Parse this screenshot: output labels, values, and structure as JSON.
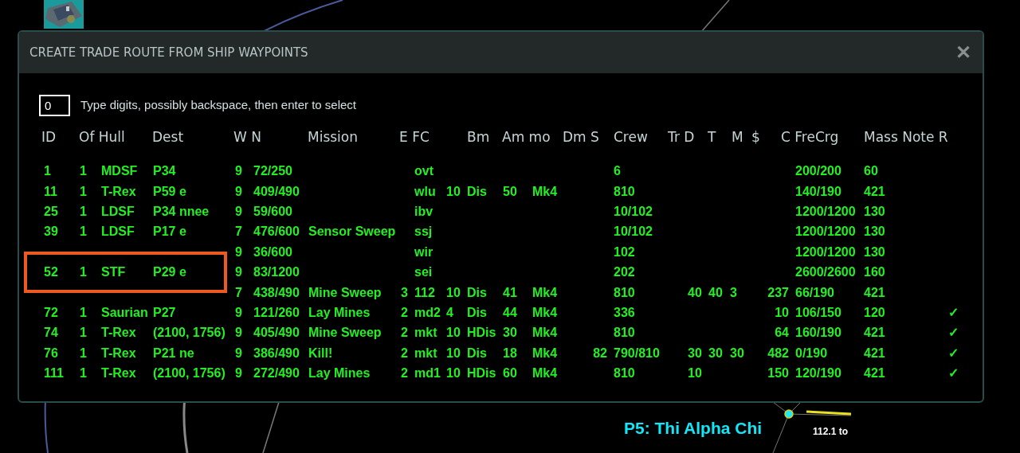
{
  "map": {
    "planet_label": "P5: Thi Alpha Chi",
    "distance_label": "112.1 to"
  },
  "dialog": {
    "title": "CREATE TRADE ROUTE FROM SHIP WAYPOINTS",
    "close_symbol": "✕",
    "selector": {
      "value": "0",
      "hint": "Type digits, possibly backspace, then enter to select"
    },
    "headers": [
      "ID",
      "Of Hull",
      "Dest",
      "W N",
      "Mission",
      "E FC",
      "Bm",
      "Am mo",
      "Dm S",
      "Crew",
      "Tr D",
      "T",
      "M",
      "$",
      "C FreCrg",
      "Mass Note R"
    ],
    "rows": [
      {
        "highlighted": false,
        "cells": {
          "id": "1",
          "of": "1",
          "hull": "MDSF",
          "dest": "P34",
          "w": "9",
          "n": "72/250",
          "fc": "ovt",
          "crew": "6",
          "fre_crg": "200/200",
          "mass": "60"
        }
      },
      {
        "highlighted": false,
        "cells": {
          "id": "11",
          "of": "1",
          "hull": "T-Rex",
          "dest": "P59 e",
          "w": "9",
          "n": "409/490",
          "fc": "wlu",
          "column_10": "10",
          "bm": "Dis",
          "am": "50",
          "mo": "Mk4",
          "crew": "810",
          "fre_crg": "140/190",
          "mass": "421"
        }
      },
      {
        "highlighted": false,
        "cells": {
          "id": "25",
          "of": "1",
          "hull": "LDSF",
          "dest": "P34 nnee",
          "w": "9",
          "n": "59/600",
          "fc": "ibv",
          "crew": "10/102",
          "fre_crg": "1200/1200",
          "mass": "130"
        }
      },
      {
        "highlighted": false,
        "cells": {
          "id": "39",
          "of": "1",
          "hull": "LDSF",
          "dest": "P17 e",
          "w": "7",
          "n": "476/600",
          "mission": "Sensor Sweep",
          "fc": "ssj",
          "crew": "10/102",
          "fre_crg": "1200/1200",
          "mass": "130"
        }
      },
      {
        "highlighted": false,
        "cells": {
          "w": "9",
          "n": "36/600",
          "fc": "wir",
          "crew": "102",
          "fre_crg": "1200/1200",
          "mass": "130"
        }
      },
      {
        "highlighted": true,
        "cells": {
          "id": "52",
          "of": "1",
          "hull": "STF",
          "dest": "P29 e",
          "w": "9",
          "n": "83/1200",
          "fc": "sei",
          "crew": "202",
          "fre_crg": "2600/2600",
          "mass": "160"
        }
      },
      {
        "highlighted": false,
        "cells": {
          "w": "7",
          "n": "438/490",
          "mission": "Mine Sweep",
          "e": "3",
          "fc": "112",
          "column_10": "10",
          "bm": "Dis",
          "am": "41",
          "mo": "Mk4",
          "crew": "810",
          "d": "40",
          "t": "40",
          "m": "3",
          "dollar": "237",
          "fre_crg": "66/190",
          "mass": "421"
        }
      },
      {
        "highlighted": false,
        "cells": {
          "id": "72",
          "of": "1",
          "hull": "Saurian",
          "dest": "P27",
          "w": "9",
          "n": "121/260",
          "mission": "Lay Mines",
          "e": "2",
          "fc": "md2",
          "column_10": "4",
          "bm": "Dis",
          "am": "44",
          "mo": "Mk4",
          "crew": "336",
          "dollar": "10",
          "fre_crg": "106/150",
          "mass": "120",
          "r": "✓"
        }
      },
      {
        "highlighted": false,
        "cells": {
          "id": "74",
          "of": "1",
          "hull": "T-Rex",
          "dest": "(2100, 1756)",
          "w": "9",
          "n": "405/490",
          "mission": "Mine Sweep",
          "e": "2",
          "fc": "mkt",
          "column_10": "10",
          "bm": "HDis",
          "am": "30",
          "mo": "Mk4",
          "crew": "810",
          "dollar": "64",
          "fre_crg": "160/190",
          "mass": "421",
          "r": "✓"
        }
      },
      {
        "highlighted": false,
        "cells": {
          "id": "76",
          "of": "1",
          "hull": "T-Rex",
          "dest": "P21 ne",
          "w": "9",
          "n": "386/490",
          "mission": "Kill!",
          "e": "2",
          "fc": "mkt",
          "column_10": "10",
          "bm": "Dis",
          "am": "18",
          "mo": "Mk4",
          "dm": "82",
          "crew": "790/810",
          "d": "30",
          "t": "30",
          "m": "30",
          "dollar": "482",
          "fre_crg": "0/190",
          "mass": "421",
          "r": "✓"
        }
      },
      {
        "highlighted": false,
        "cells": {
          "id": "111",
          "of": "1",
          "hull": "T-Rex",
          "dest": "(2100, 1756)",
          "w": "9",
          "n": "272/490",
          "mission": "Lay Mines",
          "e": "2",
          "fc": "md1",
          "column_10": "10",
          "bm": "HDis",
          "am": "60",
          "mo": "Mk4",
          "crew": "810",
          "d": "10",
          "dollar": "150",
          "fre_crg": "120/190",
          "mass": "421",
          "r": "✓"
        }
      }
    ]
  }
}
